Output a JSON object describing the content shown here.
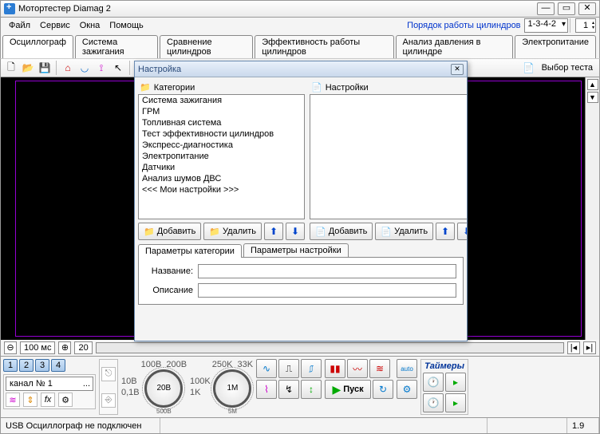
{
  "title": "Мотортестер Diamag 2",
  "menu": [
    "Файл",
    "Сервис",
    "Окна",
    "Помощь"
  ],
  "order_label": "Порядок работы цилиндров",
  "order_value": "1-3-4-2",
  "cyl_spin": "1",
  "tabs": [
    "Осциллограф",
    "Система зажигания",
    "Сравнение цилиндров",
    "Эффективность работы цилиндров",
    "Анализ давления в цилиндре",
    "Электропитание"
  ],
  "active_tab": 0,
  "test_select": "Выбор теста",
  "scrub": {
    "unit_val": "100",
    "unit": "мс",
    "val2": "20"
  },
  "numpills": [
    "1",
    "2",
    "3",
    "4"
  ],
  "channel": "канал № 1",
  "knob1": "20В",
  "knob1_labels_top": [
    "10В",
    "100В",
    "200В"
  ],
  "knob1_labels_bot": [
    "0,1В",
    "500В"
  ],
  "knob2": "1М",
  "knob2_labels_top": [
    "100K",
    "250K",
    "33K"
  ],
  "knob2_labels_bot": [
    "1K",
    "5M"
  ],
  "start_btn": "Пуск",
  "auto_btn": "auto",
  "timers_hdr": "Таймеры",
  "status_left": "USB Осциллограф не подключен",
  "status_ver": "1.9",
  "dialog": {
    "title": "Настройка",
    "cat_header": "Категории",
    "set_header": "Настройки",
    "categories": [
      "Система зажигания",
      "ГРМ",
      "Топливная система",
      "Тест эффективности цилиндров",
      "Экспресс-диагностика",
      "Электропитание",
      "Датчики",
      "Анализ шумов ДВС",
      "<<< Мои настройки >>>"
    ],
    "add": "Добавить",
    "del": "Удалить",
    "tab1": "Параметры категории",
    "tab2": "Параметры настройки",
    "name_lbl": "Название:",
    "desc_lbl": "Описание"
  }
}
